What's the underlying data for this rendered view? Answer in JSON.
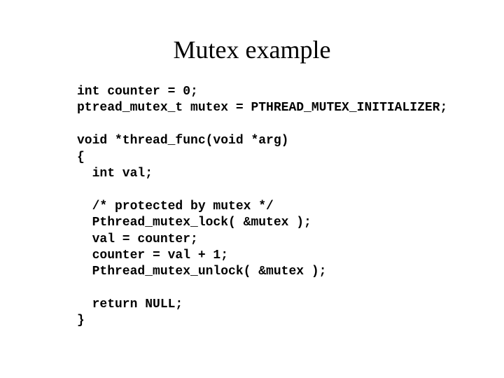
{
  "title": "Mutex example",
  "code": "int counter = 0;\nptread_mutex_t mutex = PTHREAD_MUTEX_INITIALIZER;\n\nvoid *thread_func(void *arg)\n{\n  int val;\n\n  /* protected by mutex */\n  Pthread_mutex_lock( &mutex );\n  val = counter;\n  counter = val + 1;\n  Pthread_mutex_unlock( &mutex );\n\n  return NULL;\n}"
}
